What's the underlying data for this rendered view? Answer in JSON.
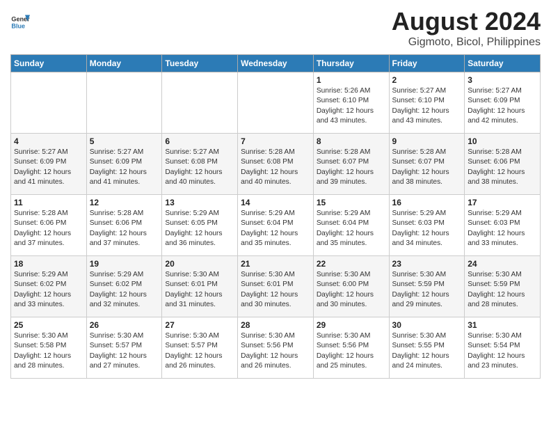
{
  "header": {
    "logo_line1": "General",
    "logo_line2": "Blue",
    "main_title": "August 2024",
    "subtitle": "Gigmoto, Bicol, Philippines"
  },
  "days_header": [
    "Sunday",
    "Monday",
    "Tuesday",
    "Wednesday",
    "Thursday",
    "Friday",
    "Saturday"
  ],
  "weeks": [
    [
      {
        "day": "",
        "content": ""
      },
      {
        "day": "",
        "content": ""
      },
      {
        "day": "",
        "content": ""
      },
      {
        "day": "",
        "content": ""
      },
      {
        "day": "1",
        "content": "Sunrise: 5:26 AM\nSunset: 6:10 PM\nDaylight: 12 hours\nand 43 minutes."
      },
      {
        "day": "2",
        "content": "Sunrise: 5:27 AM\nSunset: 6:10 PM\nDaylight: 12 hours\nand 43 minutes."
      },
      {
        "day": "3",
        "content": "Sunrise: 5:27 AM\nSunset: 6:09 PM\nDaylight: 12 hours\nand 42 minutes."
      }
    ],
    [
      {
        "day": "4",
        "content": "Sunrise: 5:27 AM\nSunset: 6:09 PM\nDaylight: 12 hours\nand 41 minutes."
      },
      {
        "day": "5",
        "content": "Sunrise: 5:27 AM\nSunset: 6:09 PM\nDaylight: 12 hours\nand 41 minutes."
      },
      {
        "day": "6",
        "content": "Sunrise: 5:27 AM\nSunset: 6:08 PM\nDaylight: 12 hours\nand 40 minutes."
      },
      {
        "day": "7",
        "content": "Sunrise: 5:28 AM\nSunset: 6:08 PM\nDaylight: 12 hours\nand 40 minutes."
      },
      {
        "day": "8",
        "content": "Sunrise: 5:28 AM\nSunset: 6:07 PM\nDaylight: 12 hours\nand 39 minutes."
      },
      {
        "day": "9",
        "content": "Sunrise: 5:28 AM\nSunset: 6:07 PM\nDaylight: 12 hours\nand 38 minutes."
      },
      {
        "day": "10",
        "content": "Sunrise: 5:28 AM\nSunset: 6:06 PM\nDaylight: 12 hours\nand 38 minutes."
      }
    ],
    [
      {
        "day": "11",
        "content": "Sunrise: 5:28 AM\nSunset: 6:06 PM\nDaylight: 12 hours\nand 37 minutes."
      },
      {
        "day": "12",
        "content": "Sunrise: 5:28 AM\nSunset: 6:06 PM\nDaylight: 12 hours\nand 37 minutes."
      },
      {
        "day": "13",
        "content": "Sunrise: 5:29 AM\nSunset: 6:05 PM\nDaylight: 12 hours\nand 36 minutes."
      },
      {
        "day": "14",
        "content": "Sunrise: 5:29 AM\nSunset: 6:04 PM\nDaylight: 12 hours\nand 35 minutes."
      },
      {
        "day": "15",
        "content": "Sunrise: 5:29 AM\nSunset: 6:04 PM\nDaylight: 12 hours\nand 35 minutes."
      },
      {
        "day": "16",
        "content": "Sunrise: 5:29 AM\nSunset: 6:03 PM\nDaylight: 12 hours\nand 34 minutes."
      },
      {
        "day": "17",
        "content": "Sunrise: 5:29 AM\nSunset: 6:03 PM\nDaylight: 12 hours\nand 33 minutes."
      }
    ],
    [
      {
        "day": "18",
        "content": "Sunrise: 5:29 AM\nSunset: 6:02 PM\nDaylight: 12 hours\nand 33 minutes."
      },
      {
        "day": "19",
        "content": "Sunrise: 5:29 AM\nSunset: 6:02 PM\nDaylight: 12 hours\nand 32 minutes."
      },
      {
        "day": "20",
        "content": "Sunrise: 5:30 AM\nSunset: 6:01 PM\nDaylight: 12 hours\nand 31 minutes."
      },
      {
        "day": "21",
        "content": "Sunrise: 5:30 AM\nSunset: 6:01 PM\nDaylight: 12 hours\nand 30 minutes."
      },
      {
        "day": "22",
        "content": "Sunrise: 5:30 AM\nSunset: 6:00 PM\nDaylight: 12 hours\nand 30 minutes."
      },
      {
        "day": "23",
        "content": "Sunrise: 5:30 AM\nSunset: 5:59 PM\nDaylight: 12 hours\nand 29 minutes."
      },
      {
        "day": "24",
        "content": "Sunrise: 5:30 AM\nSunset: 5:59 PM\nDaylight: 12 hours\nand 28 minutes."
      }
    ],
    [
      {
        "day": "25",
        "content": "Sunrise: 5:30 AM\nSunset: 5:58 PM\nDaylight: 12 hours\nand 28 minutes."
      },
      {
        "day": "26",
        "content": "Sunrise: 5:30 AM\nSunset: 5:57 PM\nDaylight: 12 hours\nand 27 minutes."
      },
      {
        "day": "27",
        "content": "Sunrise: 5:30 AM\nSunset: 5:57 PM\nDaylight: 12 hours\nand 26 minutes."
      },
      {
        "day": "28",
        "content": "Sunrise: 5:30 AM\nSunset: 5:56 PM\nDaylight: 12 hours\nand 26 minutes."
      },
      {
        "day": "29",
        "content": "Sunrise: 5:30 AM\nSunset: 5:56 PM\nDaylight: 12 hours\nand 25 minutes."
      },
      {
        "day": "30",
        "content": "Sunrise: 5:30 AM\nSunset: 5:55 PM\nDaylight: 12 hours\nand 24 minutes."
      },
      {
        "day": "31",
        "content": "Sunrise: 5:30 AM\nSunset: 5:54 PM\nDaylight: 12 hours\nand 23 minutes."
      }
    ]
  ]
}
